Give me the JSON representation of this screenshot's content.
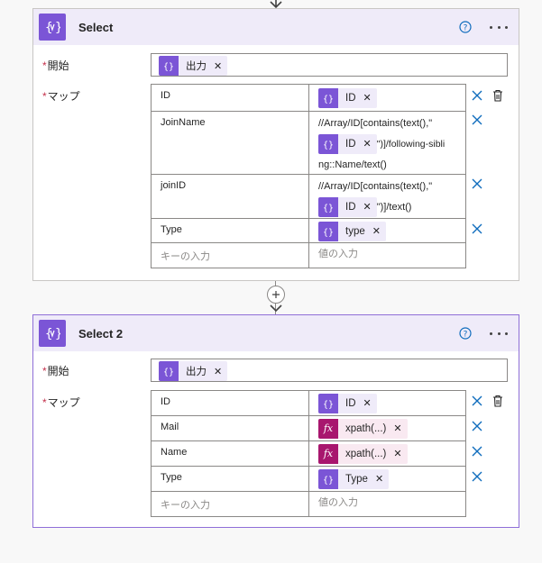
{
  "cards": [
    {
      "title": "Select",
      "start_label": "開始",
      "map_label": "マップ",
      "start_token": "出力",
      "rows": [
        {
          "key": "ID",
          "value_token": "ID"
        },
        {
          "key": "JoinName",
          "value_pre": "//Array/ID[contains(text(),\"",
          "value_token": "ID",
          "value_post": "\")]/following-sibli",
          "value_tail": "ng::Name/text()"
        },
        {
          "key": "joinID",
          "value_pre": "//Array/ID[contains(text(),\"",
          "value_token": "ID",
          "value_post": "\")]/text()"
        },
        {
          "key": "Type",
          "value_token": "type"
        }
      ],
      "key_placeholder": "キーの入力",
      "value_placeholder": "値の入力"
    },
    {
      "title": "Select 2",
      "start_label": "開始",
      "map_label": "マップ",
      "start_token": "出力",
      "rows": [
        {
          "key": "ID",
          "value_token": "ID"
        },
        {
          "key": "Mail",
          "value_token": "xpath(...)"
        },
        {
          "key": "Name",
          "value_token": "xpath(...)"
        },
        {
          "key": "Type",
          "value_token": "Type"
        }
      ],
      "key_placeholder": "キーの入力",
      "value_placeholder": "値の入力"
    }
  ],
  "icons": {
    "action": "select-action-icon",
    "help": "help-circle-icon",
    "more": "more-options-icon",
    "remove": "close-icon",
    "delete": "delete-icon",
    "expression": "fx-icon",
    "add": "plus-icon"
  },
  "colors": {
    "accent": "#7b55d6",
    "header_bg": "#efebf9",
    "expression": "#a8166e",
    "link_blue": "#0f6cbd",
    "required": "#c4314b"
  }
}
